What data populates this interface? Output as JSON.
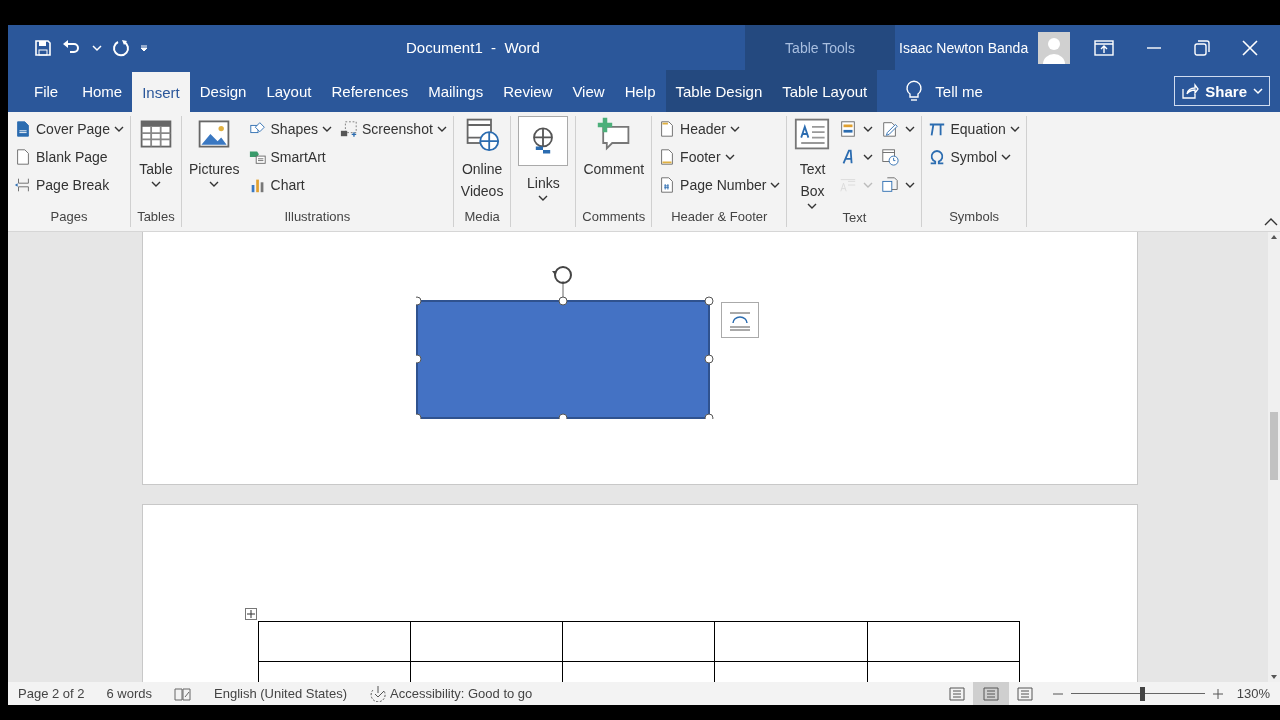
{
  "title_bar": {
    "document_title": "Document1  -  Word",
    "context_label": "Table Tools",
    "user_name": "Isaac Newton Banda"
  },
  "tabs": [
    {
      "label": "File",
      "selected": false,
      "kind": "normal"
    },
    {
      "label": "Home",
      "selected": false,
      "kind": "normal"
    },
    {
      "label": "Insert",
      "selected": true,
      "kind": "normal"
    },
    {
      "label": "Design",
      "selected": false,
      "kind": "normal"
    },
    {
      "label": "Layout",
      "selected": false,
      "kind": "normal"
    },
    {
      "label": "References",
      "selected": false,
      "kind": "normal"
    },
    {
      "label": "Mailings",
      "selected": false,
      "kind": "normal"
    },
    {
      "label": "Review",
      "selected": false,
      "kind": "normal"
    },
    {
      "label": "View",
      "selected": false,
      "kind": "normal"
    },
    {
      "label": "Help",
      "selected": false,
      "kind": "normal"
    },
    {
      "label": "Table Design",
      "selected": false,
      "kind": "contextual"
    },
    {
      "label": "Table Layout",
      "selected": false,
      "kind": "contextual"
    }
  ],
  "tell_me": "Tell me",
  "share": "Share",
  "ribbon": {
    "groups": [
      {
        "label": "Pages",
        "columns": [
          [
            {
              "kind": "small",
              "label": "Cover Page",
              "caret": true
            },
            {
              "kind": "small",
              "label": "Blank Page",
              "caret": false
            },
            {
              "kind": "small",
              "label": "Page Break",
              "caret": false
            }
          ]
        ]
      },
      {
        "label": "Tables",
        "columns": [
          [
            {
              "kind": "large",
              "label": "Table",
              "caret": true
            }
          ]
        ]
      },
      {
        "label": "Illustrations",
        "columns": [
          [
            {
              "kind": "large",
              "label": "Pictures",
              "caret": true
            }
          ],
          [
            {
              "kind": "small",
              "label": "Shapes",
              "caret": true
            },
            {
              "kind": "small",
              "label": "SmartArt",
              "caret": false
            },
            {
              "kind": "small",
              "label": "Chart",
              "caret": false
            }
          ],
          [
            {
              "kind": "small",
              "label": "Screenshot",
              "caret": true
            }
          ]
        ]
      },
      {
        "label": "Media",
        "columns": [
          [
            {
              "kind": "large",
              "label": "Online Videos",
              "caret": false
            }
          ]
        ]
      },
      {
        "columns": [
          [
            {
              "kind": "large",
              "label": "Links",
              "caret": true
            }
          ]
        ]
      },
      {
        "label": "Comments",
        "columns": [
          [
            {
              "kind": "large",
              "label": "Comment",
              "caret": false
            }
          ]
        ]
      },
      {
        "label": "Header & Footer",
        "columns": [
          [
            {
              "kind": "small",
              "label": "Header",
              "caret": true
            },
            {
              "kind": "small",
              "label": "Footer",
              "caret": true
            },
            {
              "kind": "small",
              "label": "Page Number",
              "caret": true
            }
          ]
        ]
      },
      {
        "label": "Text",
        "columns": [
          [
            {
              "kind": "large",
              "label": "Text Box",
              "caret": true
            }
          ],
          [
            {
              "kind": "icon",
              "caret": true,
              "disabled": false
            },
            {
              "kind": "icon",
              "caret": true,
              "disabled": false
            },
            {
              "kind": "icon",
              "caret": true,
              "disabled": true
            }
          ],
          [
            {
              "kind": "icon",
              "caret": true,
              "disabled": false
            },
            {
              "kind": "icon",
              "caret": false,
              "disabled": false
            },
            {
              "kind": "icon",
              "caret": true,
              "disabled": false
            }
          ]
        ]
      },
      {
        "label": "Symbols",
        "columns": [
          [
            {
              "kind": "small",
              "label": "Equation",
              "caret": true
            },
            {
              "kind": "small",
              "label": "Symbol",
              "caret": true
            }
          ]
        ]
      }
    ]
  },
  "status_bar": {
    "items": [
      "Page 2 of 2",
      "6 words",
      "English (United States)",
      "Accessibility: Good to go"
    ],
    "views": [
      {
        "selected": false
      },
      {
        "selected": true
      },
      {
        "selected": false
      }
    ],
    "zoom": {
      "level": 0.53,
      "reading": "130%"
    }
  }
}
